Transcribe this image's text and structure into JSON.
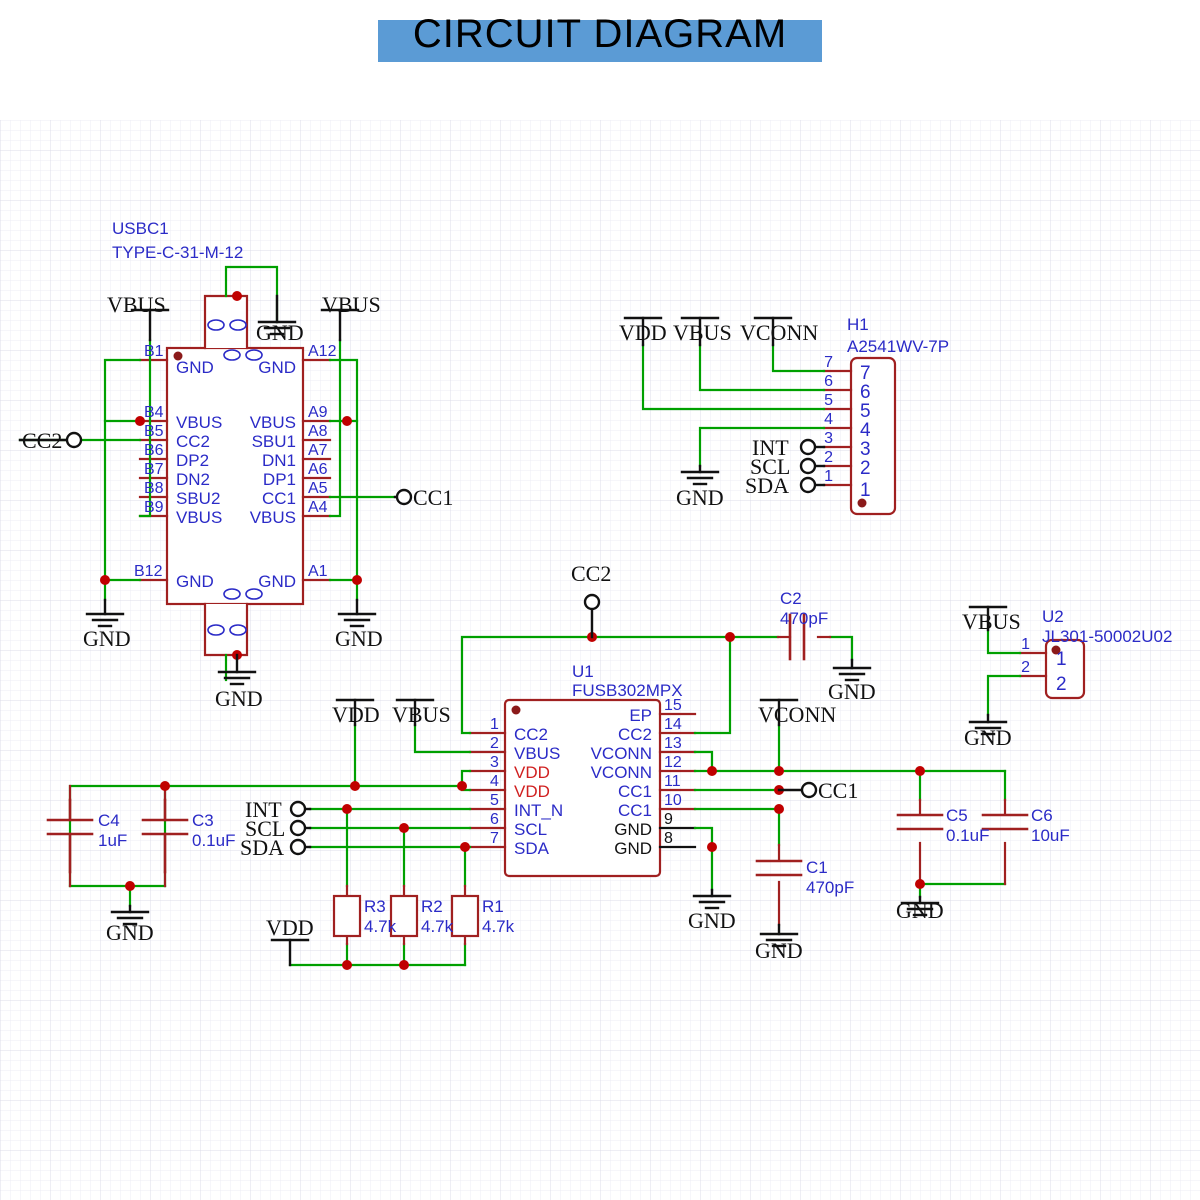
{
  "page": {
    "title": "CIRCUIT DIAGRAM",
    "banner_color": "#5b9bd5",
    "background": "#ffffff",
    "grid_color": "#e8e8f0",
    "wire_color": "#00a000",
    "symbol_color": "#a02020",
    "label_color": "#2b2bc7",
    "net_color": "#111111"
  },
  "components": {
    "usbc1": {
      "refdes": "USBC1",
      "part": "TYPE-C-31-M-12",
      "left_pins": [
        {
          "num": "B1",
          "name": "GND"
        },
        {
          "num": "B4",
          "name": "VBUS"
        },
        {
          "num": "B5",
          "name": "CC2"
        },
        {
          "num": "B6",
          "name": "DP2"
        },
        {
          "num": "B7",
          "name": "DN2"
        },
        {
          "num": "B8",
          "name": "SBU2"
        },
        {
          "num": "B9",
          "name": "VBUS"
        },
        {
          "num": "B12",
          "name": "GND"
        }
      ],
      "right_pins": [
        {
          "num": "A12",
          "name": "GND"
        },
        {
          "num": "A9",
          "name": "VBUS"
        },
        {
          "num": "A8",
          "name": "SBU1"
        },
        {
          "num": "A7",
          "name": "DN1"
        },
        {
          "num": "A6",
          "name": "DP1"
        },
        {
          "num": "A5",
          "name": "CC1"
        },
        {
          "num": "A4",
          "name": "VBUS"
        },
        {
          "num": "A1",
          "name": "GND"
        }
      ]
    },
    "h1": {
      "refdes": "H1",
      "part": "A2541WV-7P",
      "pins": [
        {
          "num": "7",
          "inner": "7"
        },
        {
          "num": "6",
          "inner": "6"
        },
        {
          "num": "5",
          "inner": "5"
        },
        {
          "num": "4",
          "inner": "4"
        },
        {
          "num": "3",
          "inner": "3"
        },
        {
          "num": "2",
          "inner": "2"
        },
        {
          "num": "1",
          "inner": "1"
        }
      ]
    },
    "u1": {
      "refdes": "U1",
      "part": "FUSB302MPX",
      "left_pins": [
        {
          "num": "1",
          "name": "CC2",
          "color": "blue"
        },
        {
          "num": "2",
          "name": "VBUS",
          "color": "blue"
        },
        {
          "num": "3",
          "name": "VDD",
          "color": "red"
        },
        {
          "num": "4",
          "name": "VDD",
          "color": "red"
        },
        {
          "num": "5",
          "name": "INT_N",
          "color": "blue"
        },
        {
          "num": "6",
          "name": "SCL",
          "color": "blue"
        },
        {
          "num": "7",
          "name": "SDA",
          "color": "blue"
        }
      ],
      "right_pins": [
        {
          "num": "15",
          "name": "EP",
          "color": "blue"
        },
        {
          "num": "14",
          "name": "CC2",
          "color": "blue"
        },
        {
          "num": "13",
          "name": "VCONN",
          "color": "blue"
        },
        {
          "num": "12",
          "name": "VCONN",
          "color": "blue"
        },
        {
          "num": "11",
          "name": "CC1",
          "color": "blue"
        },
        {
          "num": "10",
          "name": "CC1",
          "color": "blue"
        },
        {
          "num": "9",
          "name": "GND",
          "color": "black"
        },
        {
          "num": "8",
          "name": "GND",
          "color": "black"
        }
      ]
    },
    "u2": {
      "refdes": "U2",
      "part": "JL301-50002U02",
      "pins": [
        {
          "num": "1",
          "inner": "1"
        },
        {
          "num": "2",
          "inner": "2"
        }
      ]
    },
    "capacitors": [
      {
        "refdes": "C1",
        "value": "470pF"
      },
      {
        "refdes": "C2",
        "value": "470pF"
      },
      {
        "refdes": "C3",
        "value": "0.1uF"
      },
      {
        "refdes": "C4",
        "value": "1uF"
      },
      {
        "refdes": "C5",
        "value": "0.1uF"
      },
      {
        "refdes": "C6",
        "value": "10uF"
      }
    ],
    "resistors": [
      {
        "refdes": "R1",
        "value": "4.7k"
      },
      {
        "refdes": "R2",
        "value": "4.7k"
      },
      {
        "refdes": "R3",
        "value": "4.7k"
      }
    ]
  },
  "nets": {
    "vbus": "VBUS",
    "vdd": "VDD",
    "vconn": "VCONN",
    "gnd": "GND",
    "cc1": "CC1",
    "cc2": "CC2",
    "int": "INT",
    "scl": "SCL",
    "sda": "SDA"
  },
  "labels": {
    "usbc_vbus_left": "VBUS",
    "usbc_vbus_right": "VBUS",
    "usbc_gnd_top": "GND",
    "usbc_gnd_left": "GND",
    "usbc_gnd_right": "GND",
    "usbc_gnd_bottom": "GND",
    "usbc_cc2_port": "CC2",
    "usbc_cc1_port": "CC1",
    "h1_vdd": "VDD",
    "h1_vbus": "VBUS",
    "h1_vconn": "VCONN",
    "h1_gnd": "GND",
    "h1_int": "INT",
    "h1_scl": "SCL",
    "h1_sda": "SDA",
    "u1_cc2_port": "CC2",
    "u1_vdd": "VDD",
    "u1_vbus": "VBUS",
    "u1_int": "INT",
    "u1_scl": "SCL",
    "u1_sda": "SDA",
    "u1_vconn": "VCONN",
    "u1_cc1_port": "CC1",
    "c2_gnd": "GND",
    "c1_gnd": "GND",
    "u1_gnd": "GND",
    "c34_gnd": "GND",
    "r_vdd": "VDD",
    "c56_gnd": "GND",
    "u2_vbus": "VBUS",
    "u2_gnd": "GND"
  }
}
